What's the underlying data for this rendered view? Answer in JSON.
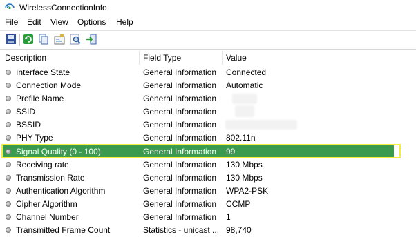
{
  "window": {
    "title": "WirelessConnectionInfo"
  },
  "menu": [
    "File",
    "Edit",
    "View",
    "Options",
    "Help"
  ],
  "toolbar": [
    "save-icon",
    "refresh-icon",
    "copy-icon",
    "properties-icon",
    "find-icon",
    "exit-icon"
  ],
  "columns": [
    "Description",
    "Field Type",
    "Value"
  ],
  "rows": [
    {
      "description": "Interface State",
      "field_type": "General Information",
      "value": "Connected"
    },
    {
      "description": "Connection Mode",
      "field_type": "General Information",
      "value": "Automatic"
    },
    {
      "description": "Profile Name",
      "field_type": "General Information",
      "value": ""
    },
    {
      "description": "SSID",
      "field_type": "General Information",
      "value": ""
    },
    {
      "description": "BSSID",
      "field_type": "General Information",
      "value": ""
    },
    {
      "description": "PHY Type",
      "field_type": "General Information",
      "value": "802.11n"
    },
    {
      "description": "Signal Quality (0 - 100)",
      "field_type": "General Information",
      "value": "99",
      "selected": true
    },
    {
      "description": "Receiving rate",
      "field_type": "General Information",
      "value": "130 Mbps"
    },
    {
      "description": "Transmission Rate",
      "field_type": "General Information",
      "value": "130 Mbps"
    },
    {
      "description": "Authentication Algorithm",
      "field_type": "General Information",
      "value": "WPA2-PSK"
    },
    {
      "description": "Cipher Algorithm",
      "field_type": "General Information",
      "value": "CCMP"
    },
    {
      "description": "Channel Number",
      "field_type": "General Information",
      "value": "1"
    },
    {
      "description": "Transmitted Frame Count",
      "field_type": "Statistics - unicast ...",
      "value": "98,740"
    }
  ],
  "colors": {
    "selection": "#3a9b4f",
    "outline": "#f4ee3c"
  }
}
